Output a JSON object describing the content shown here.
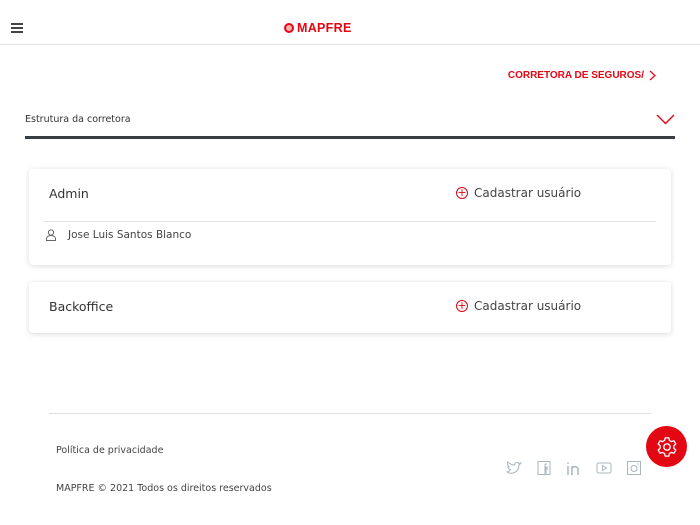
{
  "header": {
    "logo": "MAPFRE"
  },
  "breadcrumb": "CORRETORA DE SEGUROS/",
  "dropdown": {
    "label": "Estrutura da corretora"
  },
  "groups": [
    {
      "title": "Admin",
      "add_label": "Cadastrar usuário",
      "users": [
        "Jose Luis Santos Blanco"
      ]
    },
    {
      "title": "Backoffice",
      "add_label": "Cadastrar usuário",
      "users": []
    }
  ],
  "footer": {
    "privacy": "Política de privacidade",
    "copyright": "MAPFRE © 2021 Todos os direitos reservados",
    "social": [
      "twitter-icon",
      "facebook-icon",
      "linkedin-icon",
      "youtube-icon",
      "instagram-icon"
    ]
  },
  "colors": {
    "brand": "#e30613"
  }
}
